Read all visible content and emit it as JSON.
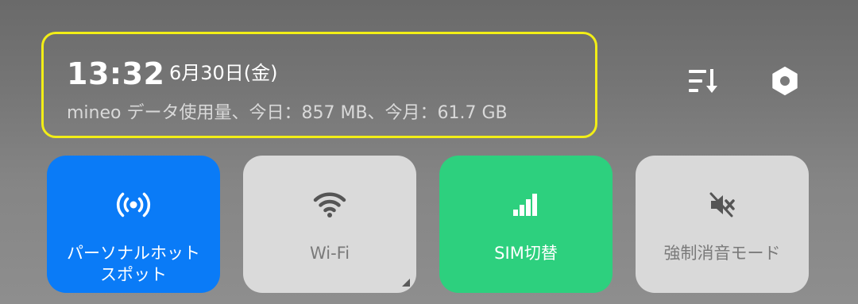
{
  "header": {
    "time": "13:32",
    "date": "6月30日(金)",
    "data_usage": "mineo データ使用量、今日：857 MB、今月：61.7 GB",
    "highlight_color": "#f2ee17"
  },
  "top_actions": {
    "sort_icon": "sort-list-icon",
    "settings_icon": "settings-icon"
  },
  "tiles": [
    {
      "label": "パーソナルホット\nスポット",
      "icon": "hotspot-icon",
      "active": true,
      "color": "#0a7bf7"
    },
    {
      "label": "Wi-Fi",
      "icon": "wifi-icon",
      "active": false,
      "color": "#dadada"
    },
    {
      "label": "SIM切替",
      "icon": "signal-bars-icon",
      "active": true,
      "color": "#2dd07e"
    },
    {
      "label": "強制消音モード",
      "icon": "mute-icon",
      "active": false,
      "color": "#d9d9d9"
    }
  ]
}
